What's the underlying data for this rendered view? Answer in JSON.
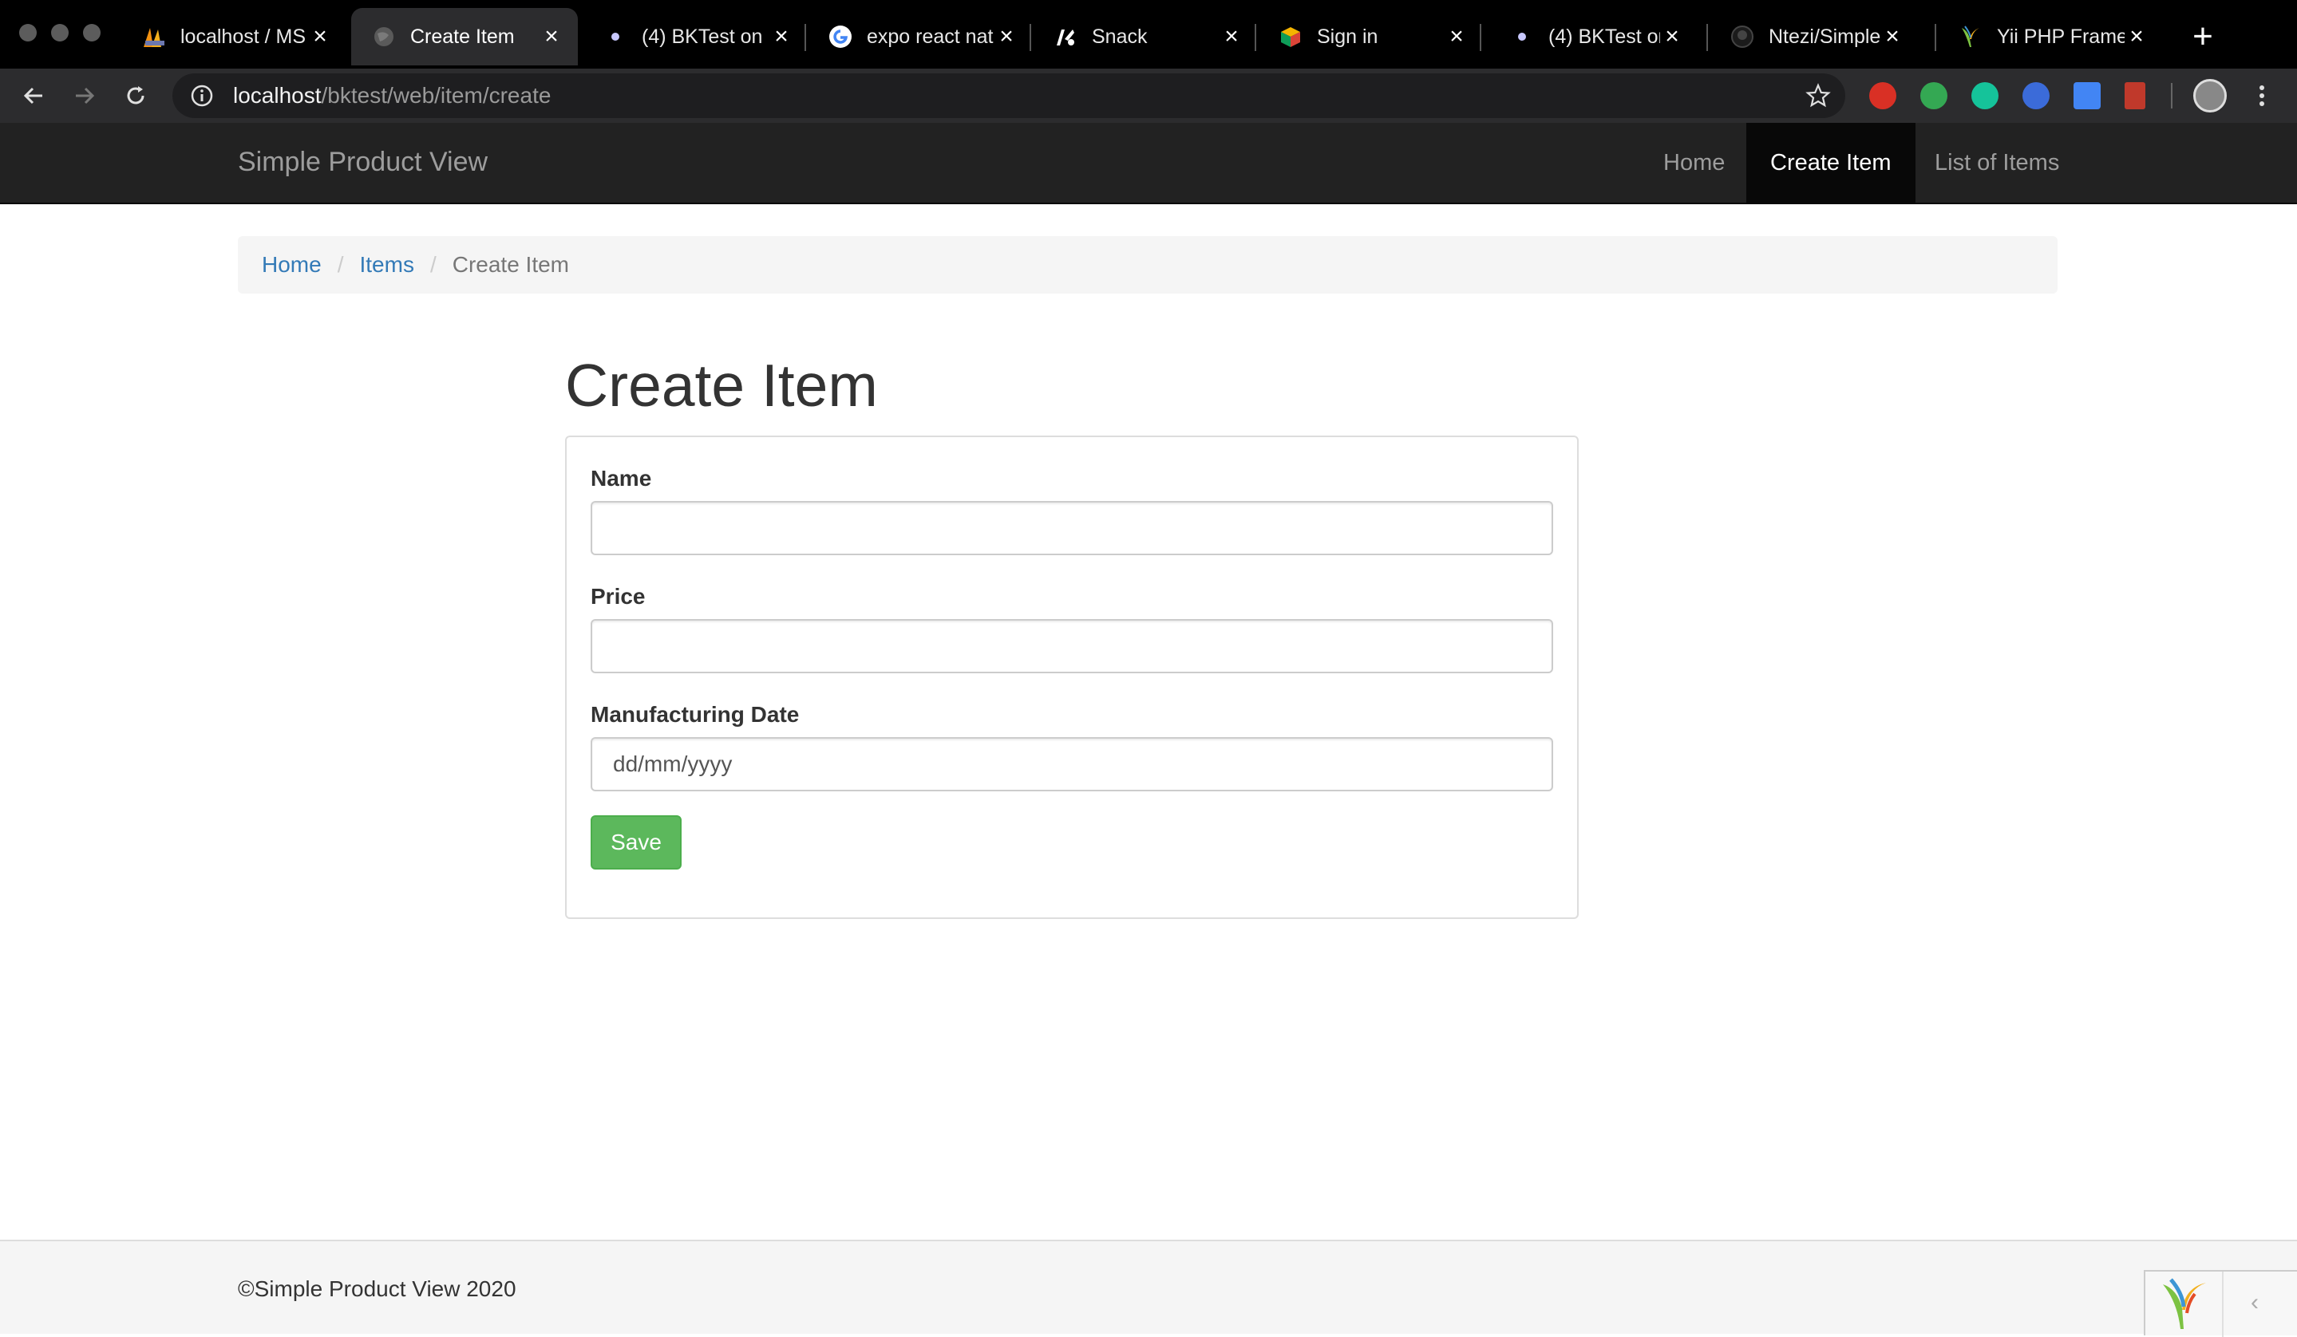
{
  "browser": {
    "tabs": [
      {
        "title": "localhost / MS",
        "icon": "phpmyadmin-icon",
        "active": false
      },
      {
        "title": "Create Item",
        "icon": "globe-icon",
        "active": true
      },
      {
        "title": "(4) BKTest on",
        "icon": "dot-icon",
        "active": false
      },
      {
        "title": "expo react nat",
        "icon": "google-icon",
        "active": false
      },
      {
        "title": "Snack",
        "icon": "snack-icon",
        "active": false
      },
      {
        "title": "Sign in",
        "icon": "cube-icon",
        "active": false
      },
      {
        "title": "(4) BKTest on",
        "icon": "dot-icon",
        "active": false
      },
      {
        "title": "Ntezi/Simple-",
        "icon": "github-icon",
        "active": false
      },
      {
        "title": "Yii PHP Frame",
        "icon": "yii-icon",
        "active": false
      }
    ],
    "url_host": "localhost",
    "url_path": "/bktest/web/item/create"
  },
  "navbar": {
    "brand": "Simple Product View",
    "links": [
      "Home",
      "Create Item",
      "List of Items"
    ],
    "active_link": "Create Item"
  },
  "breadcrumb": {
    "items": [
      "Home",
      "Items"
    ],
    "current": "Create Item",
    "separator": "/"
  },
  "page": {
    "title": "Create Item"
  },
  "form": {
    "name_label": "Name",
    "name_value": "",
    "price_label": "Price",
    "price_value": "",
    "date_label": "Manufacturing Date",
    "date_placeholder": "dd/mm/yyyy",
    "save_label": "Save"
  },
  "footer": {
    "copyright": "©Simple Product View 2020",
    "toggle_glyph": "‹"
  },
  "colors": {
    "navbar_bg": "#222222",
    "link": "#337ab7",
    "success": "#5cb85c"
  }
}
